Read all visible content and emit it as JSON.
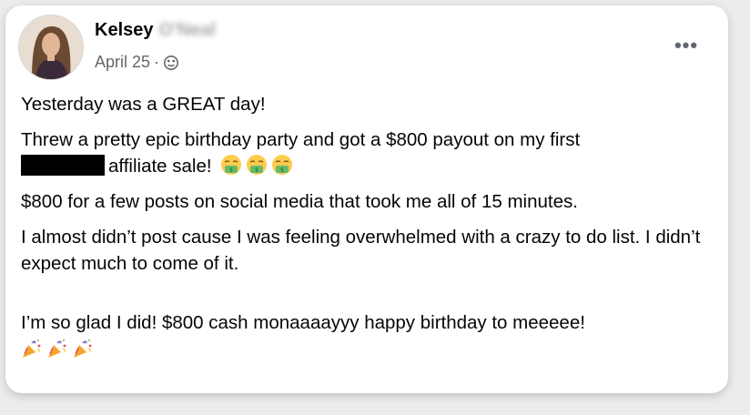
{
  "post": {
    "author_first": "Kelsey",
    "author_last_blurred": "O'Neal",
    "date": "April 25",
    "separator": "·",
    "audience_icon": "public-globe-icon",
    "more_icon": "more-options-icon",
    "more_label": "•••",
    "paragraphs": {
      "p1": "Yesterday was a GREAT day!",
      "p2a": "Threw a pretty epic birthday party and got a $800 payout on my first",
      "p2b": "affiliate sale!",
      "p3": "$800 for a few posts on social media that took me all of 15 minutes.",
      "p4": "I almost didn’t post cause I was feeling overwhelmed with a crazy to do list. I didn’t expect much to come of it.",
      "p5": "I’m so glad I did! $800 cash monaaaayyy happy birthday to meeeee!"
    },
    "emojis": {
      "money_face": "money-mouth-face-emoji",
      "party_popper": "party-popper-emoji"
    },
    "colors": {
      "text": "#050505",
      "secondary": "#65676b"
    }
  }
}
